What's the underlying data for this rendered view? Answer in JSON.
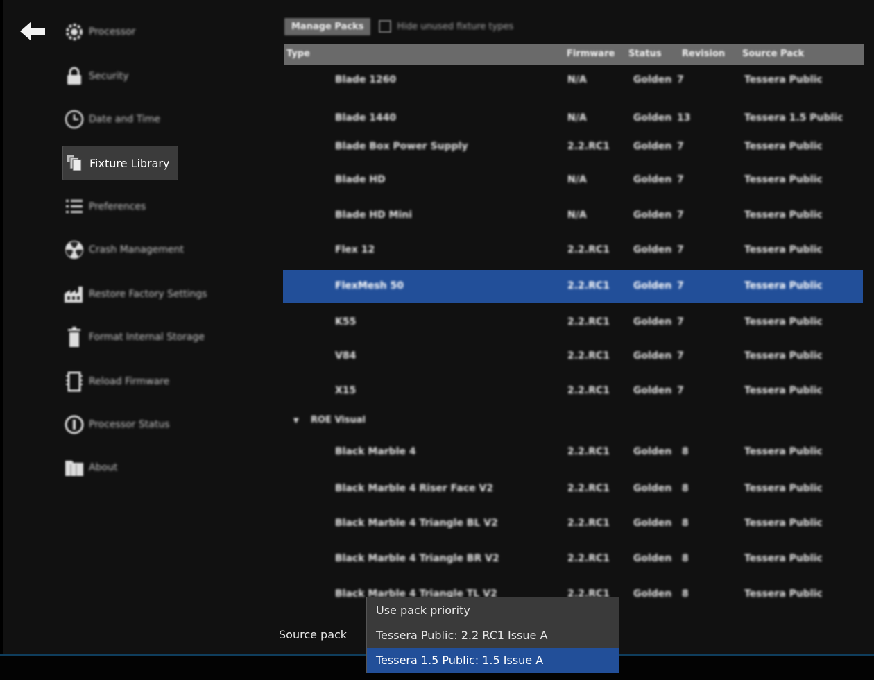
{
  "sidebar": {
    "items": [
      {
        "label": "Processor",
        "icon": "gear-icon"
      },
      {
        "label": "Security",
        "icon": "lock-icon"
      },
      {
        "label": "Date and Time",
        "icon": "clock-icon"
      },
      {
        "label": "Fixture Library",
        "icon": "library-icon"
      },
      {
        "label": "Preferences",
        "icon": "list-icon"
      },
      {
        "label": "Crash Management",
        "icon": "radiation-icon"
      },
      {
        "label": "Restore Factory Settings",
        "icon": "factory-icon"
      },
      {
        "label": "Format Internal Storage",
        "icon": "trash-icon"
      },
      {
        "label": "Reload Firmware",
        "icon": "chip-icon"
      },
      {
        "label": "Processor Status",
        "icon": "info-icon"
      },
      {
        "label": "About",
        "icon": "folder-icon"
      }
    ]
  },
  "toolbar": {
    "manage_packs": "Manage Packs",
    "hide_unused": "Hide unused fixture types"
  },
  "table": {
    "headers": {
      "type": "Type",
      "firmware": "Firmware",
      "status": "Status",
      "revision": "Revision",
      "source_pack": "Source Pack"
    },
    "rows": [
      {
        "type": "Blade 1260",
        "firmware": "N/A",
        "status": "Golden",
        "revision": "7",
        "source_pack": "Tessera Public"
      },
      {
        "type": "Blade 1440",
        "firmware": "N/A",
        "status": "Golden",
        "revision": "13",
        "source_pack": "Tessera 1.5 Public"
      },
      {
        "type": "Blade Box Power Supply",
        "firmware": "2.2.RC1",
        "status": "Golden",
        "revision": "7",
        "source_pack": "Tessera Public"
      },
      {
        "type": "Blade HD",
        "firmware": "N/A",
        "status": "Golden",
        "revision": "7",
        "source_pack": "Tessera Public"
      },
      {
        "type": "Blade HD Mini",
        "firmware": "N/A",
        "status": "Golden",
        "revision": "7",
        "source_pack": "Tessera Public"
      },
      {
        "type": "Flex 12",
        "firmware": "2.2.RC1",
        "status": "Golden",
        "revision": "7",
        "source_pack": "Tessera Public"
      },
      {
        "type": "FlexMesh 50",
        "firmware": "2.2.RC1",
        "status": "Golden",
        "revision": "7",
        "source_pack": "Tessera Public",
        "selected": true
      },
      {
        "type": "K55",
        "firmware": "2.2.RC1",
        "status": "Golden",
        "revision": "7",
        "source_pack": "Tessera Public"
      },
      {
        "type": "V84",
        "firmware": "2.2.RC1",
        "status": "Golden",
        "revision": "7",
        "source_pack": "Tessera Public"
      },
      {
        "type": "X15",
        "firmware": "2.2.RC1",
        "status": "Golden",
        "revision": "7",
        "source_pack": "Tessera Public"
      }
    ],
    "group": {
      "label": "ROE Visual",
      "expander": "▼"
    },
    "group_rows": [
      {
        "type": "Black Marble 4",
        "firmware": "2.2.RC1",
        "status": "Golden",
        "revision": "8",
        "source_pack": "Tessera Public"
      },
      {
        "type": "Black Marble 4 Riser Face V2",
        "firmware": "2.2.RC1",
        "status": "Golden",
        "revision": "8",
        "source_pack": "Tessera Public"
      },
      {
        "type": "Black Marble 4 Triangle BL V2",
        "firmware": "2.2.RC1",
        "status": "Golden",
        "revision": "8",
        "source_pack": "Tessera Public"
      },
      {
        "type": "Black Marble 4 Triangle BR V2",
        "firmware": "2.2.RC1",
        "status": "Golden",
        "revision": "8",
        "source_pack": "Tessera Public"
      },
      {
        "type": "Black Marble 4 Triangle TL V2",
        "firmware": "2.2.RC1",
        "status": "Golden",
        "revision": "8",
        "source_pack": "Tessera Public"
      }
    ]
  },
  "source_pack": {
    "label": "Source pack",
    "options": [
      "Use pack priority",
      "Tessera Public: 2.2 RC1 Issue A",
      "Tessera 1.5 Public: 1.5 Issue A"
    ],
    "selected_index": 2
  },
  "colors": {
    "selection": "#224f99",
    "header": "#6a6a6a",
    "active_nav": "#3b3b3b"
  }
}
